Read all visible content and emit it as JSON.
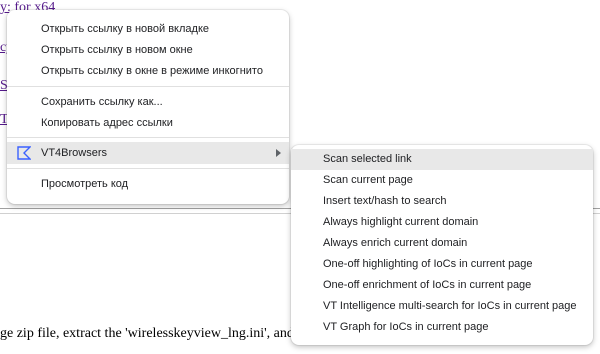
{
  "background": {
    "links": [
      "y: for x64",
      "cy",
      "S",
      "T"
    ],
    "body_text": "ge zip file, extract the 'wirelesskeyview_lng.ini', and put it into the same folder that you installed"
  },
  "context_menu": {
    "items": [
      {
        "label": "Открыть ссылку в новой вкладке"
      },
      {
        "label": "Открыть ссылку в новом окне"
      },
      {
        "label": "Открыть ссылку в окне в режиме инкогнито"
      },
      {
        "label": "Сохранить ссылку как..."
      },
      {
        "label": "Копировать адрес ссылки"
      },
      {
        "label": "VT4Browsers",
        "icon": "vt4browsers-logo-icon",
        "has_submenu": true,
        "highlighted": true
      },
      {
        "label": "Просмотреть код"
      }
    ]
  },
  "submenu": {
    "items": [
      {
        "label": "Scan selected link",
        "highlighted": true
      },
      {
        "label": "Scan current page"
      },
      {
        "label": "Insert text/hash to search"
      },
      {
        "label": "Always highlight current domain"
      },
      {
        "label": "Always enrich current domain"
      },
      {
        "label": "One-off highlighting of IoCs in current page"
      },
      {
        "label": "One-off enrichment of IoCs in current page"
      },
      {
        "label": "VT Intelligence multi-search for IoCs in current page"
      },
      {
        "label": "VT Graph for IoCs in current page"
      }
    ]
  },
  "colors": {
    "link": "#551a8b",
    "menu_bg": "#ffffff",
    "highlight": "#e8e8e8",
    "vt_icon": "#3b61ff"
  }
}
